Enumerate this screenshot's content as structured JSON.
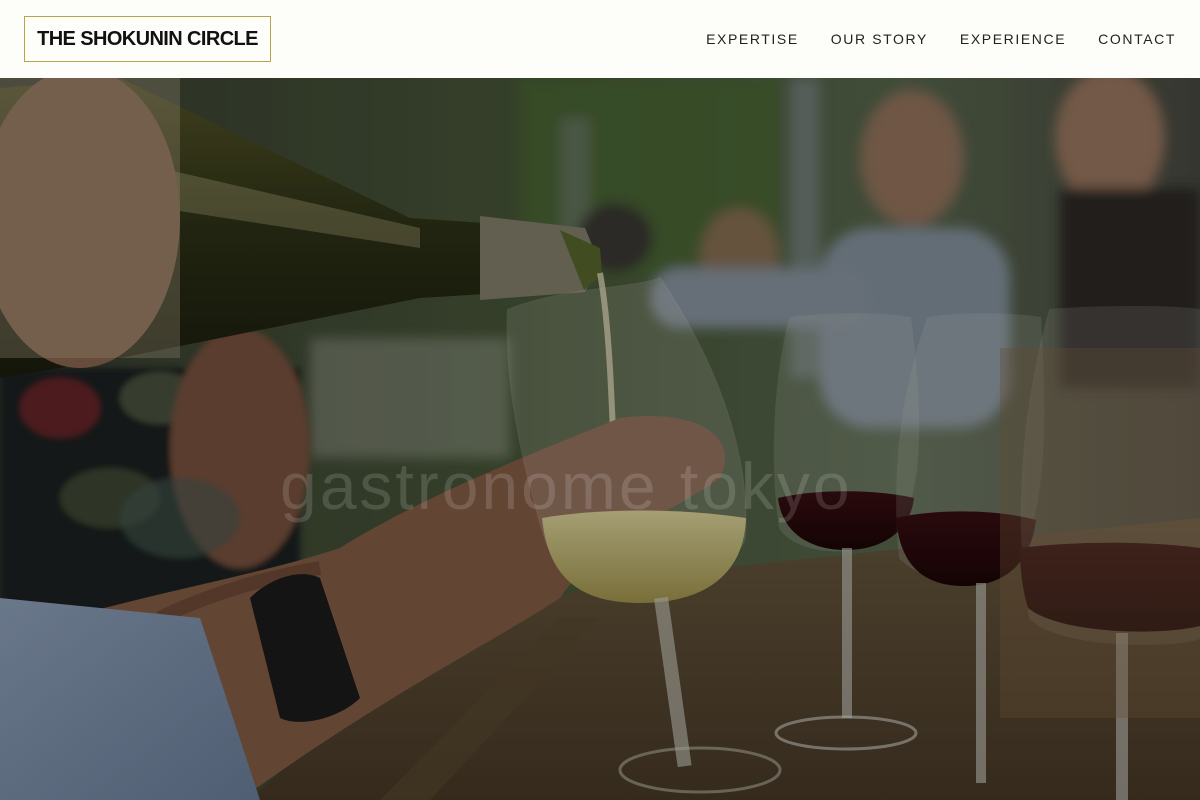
{
  "header": {
    "logo_text": "THE SHOKUNIN CIRCLE",
    "nav": [
      {
        "label": "EXPERTISE"
      },
      {
        "label": "OUR STORY"
      },
      {
        "label": "EXPERIENCE"
      },
      {
        "label": "CONTACT"
      }
    ]
  },
  "hero": {
    "watermark": "gastronome tokyo",
    "image_description_icon": "wine-tasting-photo"
  },
  "colors": {
    "header_bg": "#fdfdf9",
    "logo_border": "#b8a44a",
    "nav_text": "#222222"
  }
}
